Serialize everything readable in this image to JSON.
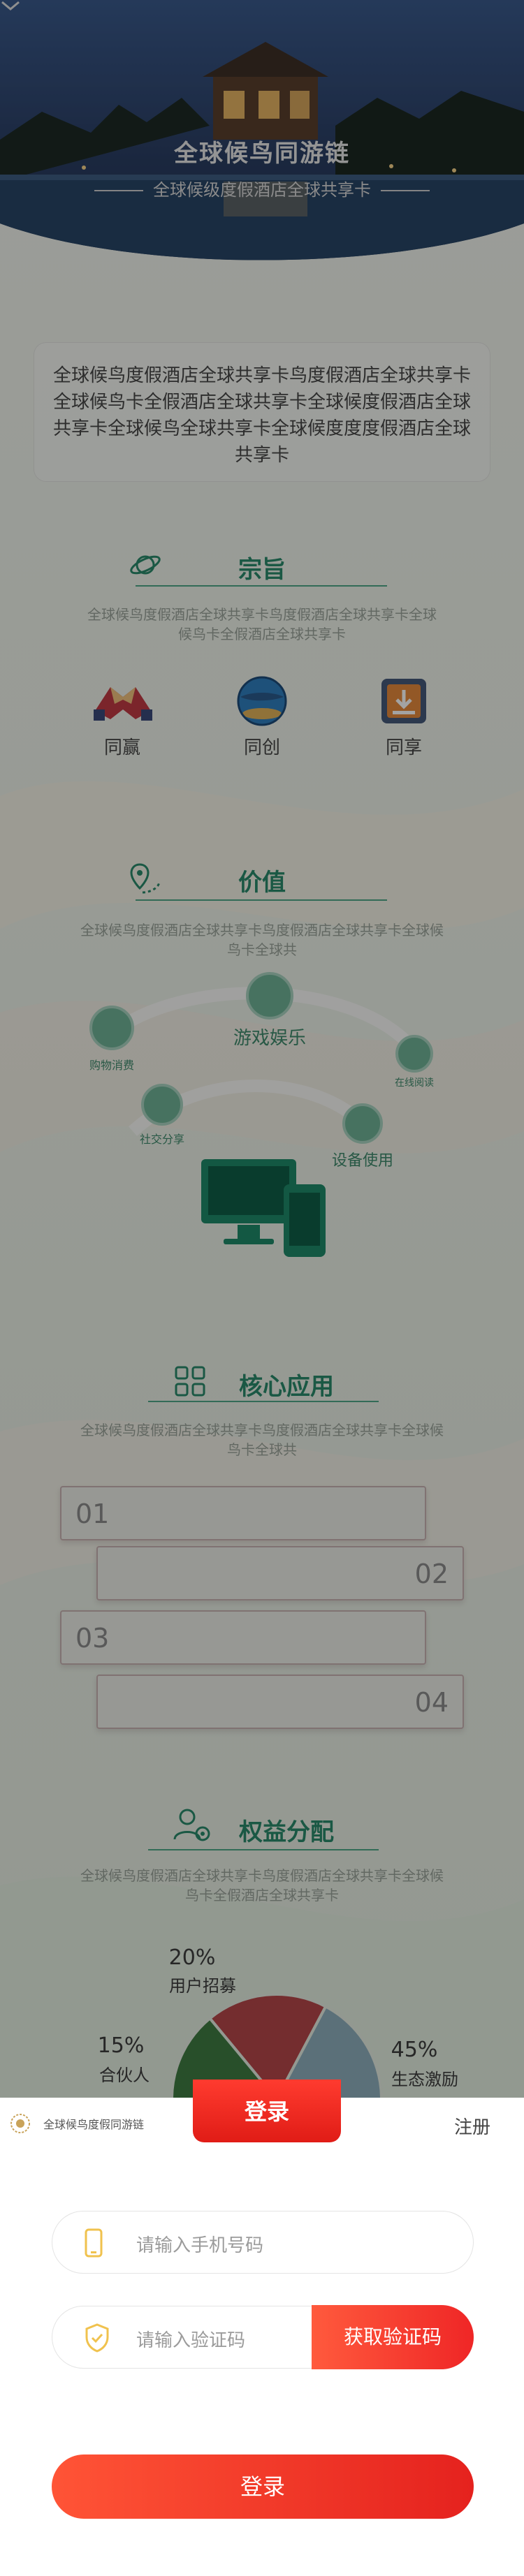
{
  "hero": {
    "title": "全球候鸟同游链",
    "subtitle": "全球候级度假酒店全球共享卡"
  },
  "intro": {
    "text": "全球候鸟度假酒店全球共享卡鸟度假酒店全球共享卡全球候鸟卡全假酒店全球共享卡全球候度假酒店全球共享卡全球候鸟全球共享卡全球候度度度假酒店全球共享卡"
  },
  "section_purpose": {
    "title": "宗旨",
    "icon": "planet-icon",
    "desc": "全球候鸟度假酒店全球共享卡鸟度假酒店全球共享卡全球候鸟卡全假酒店全球共享卡",
    "items": [
      {
        "label": "同赢",
        "icon": "handshake-icon"
      },
      {
        "label": "同创",
        "icon": "globe-icon"
      },
      {
        "label": "同享",
        "icon": "share-box-icon"
      }
    ]
  },
  "section_value": {
    "title": "价值",
    "icon": "location-route-icon",
    "desc": "全球候鸟度假酒店全球共享卡鸟度假酒店全球共享卡全球候鸟卡全球共",
    "nodes": [
      {
        "label": "购物消费",
        "icon": "shopping-icon"
      },
      {
        "label": "游戏娱乐",
        "icon": "gamepad-icon"
      },
      {
        "label": "在线阅读",
        "icon": "book-icon"
      },
      {
        "label": "社交分享",
        "icon": "social-icon"
      },
      {
        "label": "设备使用",
        "icon": "device-icon"
      }
    ]
  },
  "section_apps": {
    "title": "核心应用",
    "icon": "grid-apps-icon",
    "desc": "全球候鸟度假酒店全球共享卡鸟度假酒店全球共享卡全球候鸟卡全球共",
    "items": [
      "01",
      "02",
      "03",
      "04"
    ]
  },
  "section_rights": {
    "title": "权益分配",
    "icon": "users-gear-icon",
    "desc": "全球候鸟度假酒店全球共享卡鸟度假酒店全球共享卡全球候鸟卡全假酒店全球共享卡"
  },
  "chart_data": {
    "type": "pie",
    "title": "",
    "slices": [
      {
        "label": "用户招募",
        "value": 20,
        "display": "20%",
        "color": "#8fb0bd"
      },
      {
        "label": "合伙人",
        "value": 15,
        "display": "15%",
        "color": "#b6474a"
      },
      {
        "label": "生态激励",
        "value": 45,
        "display": "45%",
        "color": "#3f7c43"
      }
    ],
    "legend": "labels-outside"
  },
  "login_sheet": {
    "logo_text": "全球候鸟度假同游链",
    "tab_login": "登录",
    "tab_register": "注册",
    "phone_placeholder": "请输入手机号码",
    "code_placeholder": "请输入验证码",
    "get_code_label": "获取验证码",
    "submit_label": "登录"
  },
  "colors": {
    "accent": "#2a8a6b",
    "primary_red": "#e5221e",
    "field_icon": "#f0c24e"
  }
}
